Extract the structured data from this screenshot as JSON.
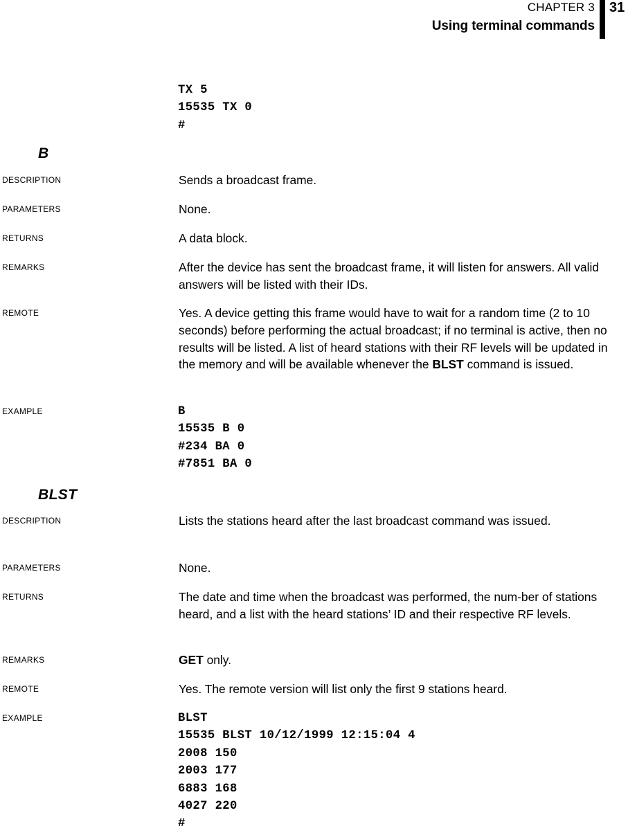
{
  "header": {
    "chapter": "CHAPTER 3",
    "title": "Using terminal commands",
    "page_number": "31",
    "rule_color": "#000000"
  },
  "top_code_block": "TX 5\n15535 TX 0\n#",
  "sections": [
    {
      "heading": "B",
      "rows": [
        {
          "label": "Description",
          "text": "Sends a broadcast frame."
        },
        {
          "label": "Parameters",
          "text": "None."
        },
        {
          "label": "Returns",
          "text": "A data block."
        },
        {
          "label": "Remarks",
          "text": "After the device has sent the broadcast frame, it will listen for answers. All valid answers will be listed with their IDs."
        },
        {
          "label": "Remote",
          "text_before": "Yes. A device getting this frame would have to wait for a random time (2 to 10 seconds) before performing the actual broadcast; if no terminal is active, then no results will be listed. A list of heard stations with their RF levels will be updated in the memory and will be available whenever the ",
          "emphasis": "BLST",
          "text_after": " command is issued."
        },
        {
          "label": "Example",
          "code": "B\n15535 B 0\n#234 BA 0\n#7851 BA 0"
        }
      ]
    },
    {
      "heading": "BLST",
      "rows": [
        {
          "label": "Description",
          "text": "Lists the stations heard after the last broadcast command was issued."
        },
        {
          "label": "Parameters",
          "text": "None."
        },
        {
          "label": "Returns",
          "text": "The date and time when the broadcast was performed, the num-ber of stations heard, and a list with the heard stations’ ID and their respective RF levels."
        },
        {
          "label": "Remarks",
          "emphasis": "GET",
          "text_after": " only."
        },
        {
          "label": "Remote",
          "text": "Yes. The remote version will list only the first 9 stations heard."
        },
        {
          "label": "Example",
          "code": "BLST\n15535 BLST 10/12/1999 12:15:04 4\n2008 150\n2003 177\n6883 168\n4027 220\n#"
        }
      ]
    }
  ]
}
